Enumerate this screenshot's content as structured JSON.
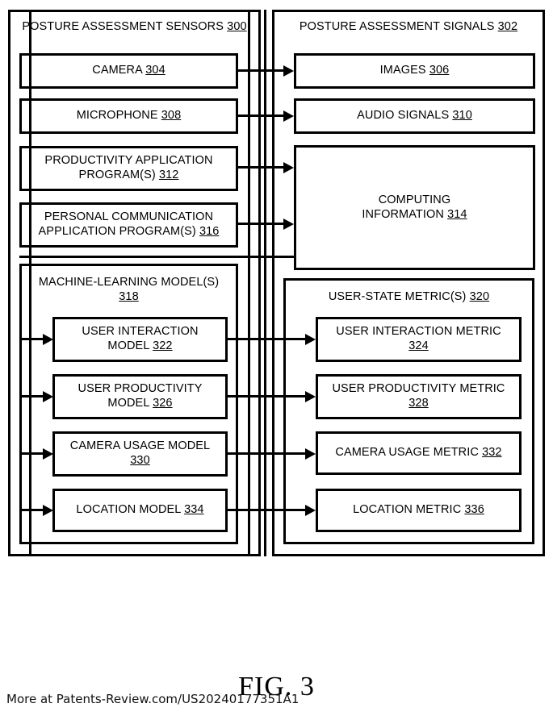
{
  "figure": {
    "caption": "FIG. 3",
    "watermark": "More at Patents-Review.com/US20240177351A1"
  },
  "columns": {
    "left": {
      "title_text": "POSTURE ASSESSMENT SENSORS ",
      "title_ref": "300",
      "boxes": [
        {
          "line1": "CAMERA ",
          "ref": "304"
        },
        {
          "line1": "MICROPHONE ",
          "ref": "308"
        },
        {
          "line1": "PRODUCTIVITY APPLICATION",
          "line2": "PROGRAM(S) ",
          "ref": "312"
        },
        {
          "line1": "PERSONAL COMMUNICATION",
          "line2": "APPLICATION PROGRAM(S) ",
          "ref": "316"
        }
      ],
      "sub_group": {
        "title_line1": "MACHINE-LEARNING MODEL(S)",
        "title_ref": "318",
        "boxes": [
          {
            "line1": "USER INTERACTION",
            "line2": "MODEL ",
            "ref": "322"
          },
          {
            "line1": "USER PRODUCTIVITY",
            "line2": "MODEL ",
            "ref": "326"
          },
          {
            "line1": "CAMERA USAGE MODEL",
            "line2": "",
            "ref": "330"
          },
          {
            "line1": "LOCATION MODEL ",
            "ref": "334"
          }
        ]
      }
    },
    "right": {
      "title_text": "POSTURE ASSESSMENT SIGNALS ",
      "title_ref": "302",
      "boxes": [
        {
          "line1": "IMAGES ",
          "ref": "306"
        },
        {
          "line1": "AUDIO SIGNALS ",
          "ref": "310"
        },
        {
          "line1": "COMPUTING",
          "line2": "INFORMATION ",
          "ref": "314"
        }
      ],
      "sub_group": {
        "title_line1": "USER-STATE METRIC(S) ",
        "title_ref": "320",
        "boxes": [
          {
            "line1": "USER INTERACTION METRIC",
            "line2": "",
            "ref": "324"
          },
          {
            "line1": "USER PRODUCTIVITY METRIC",
            "line2": "",
            "ref": "328"
          },
          {
            "line1": "CAMERA USAGE METRIC ",
            "ref": "332"
          },
          {
            "line1": "LOCATION METRIC ",
            "ref": "336"
          }
        ]
      }
    }
  },
  "colors": {
    "stroke": "#000000",
    "background": "#ffffff"
  }
}
